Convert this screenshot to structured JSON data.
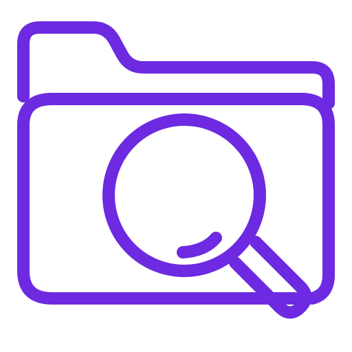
{
  "icon": {
    "name": "folder-search-icon",
    "parts": [
      "folder-icon",
      "magnifying-glass-icon"
    ],
    "style": "outline",
    "color": "#6D2AE0",
    "background": "#FFFFFF"
  }
}
